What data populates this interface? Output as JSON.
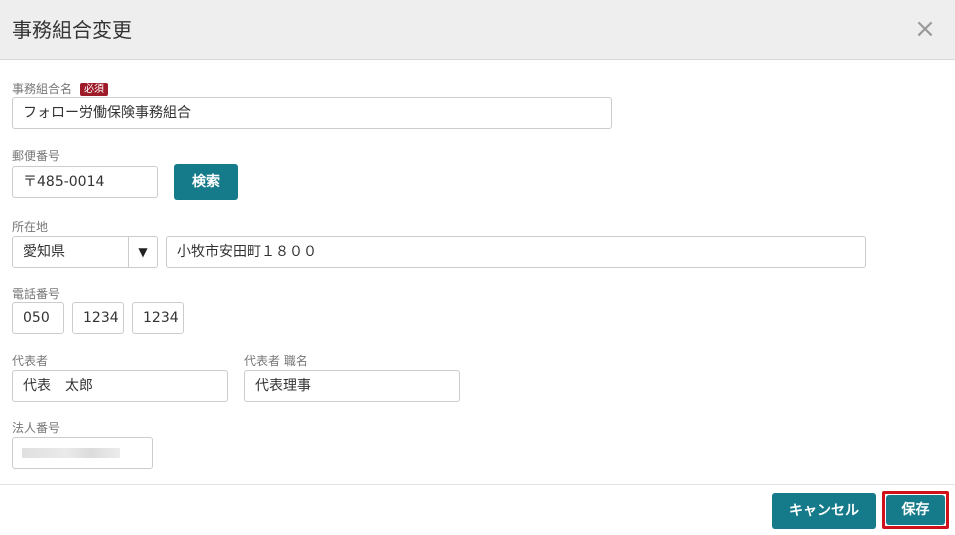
{
  "dialog": {
    "title": "事務組合変更",
    "close_glyph": "×"
  },
  "form": {
    "union_name": {
      "label": "事務組合名",
      "required_badge": "必須",
      "value": "フォロー労働保険事務組合"
    },
    "postal": {
      "label": "郵便番号",
      "value": "〒485-0014",
      "search_label": "検索"
    },
    "address": {
      "label": "所在地",
      "prefecture": "愛知県",
      "dropdown_glyph": "▼",
      "street": "小牧市安田町１８００"
    },
    "phone": {
      "label": "電話番号",
      "part1": "050",
      "part2": "1234",
      "part3": "1234"
    },
    "representative": {
      "label": "代表者",
      "value": "代表　太郎"
    },
    "rep_title": {
      "label": "代表者 職名",
      "value": "代表理事"
    },
    "corporate_number": {
      "label": "法人番号",
      "value": ""
    }
  },
  "footer": {
    "cancel_label": "キャンセル",
    "save_label": "保存"
  },
  "colors": {
    "accent": "#157a89",
    "required": "#9e1c2a",
    "highlight": "#d0101b"
  }
}
